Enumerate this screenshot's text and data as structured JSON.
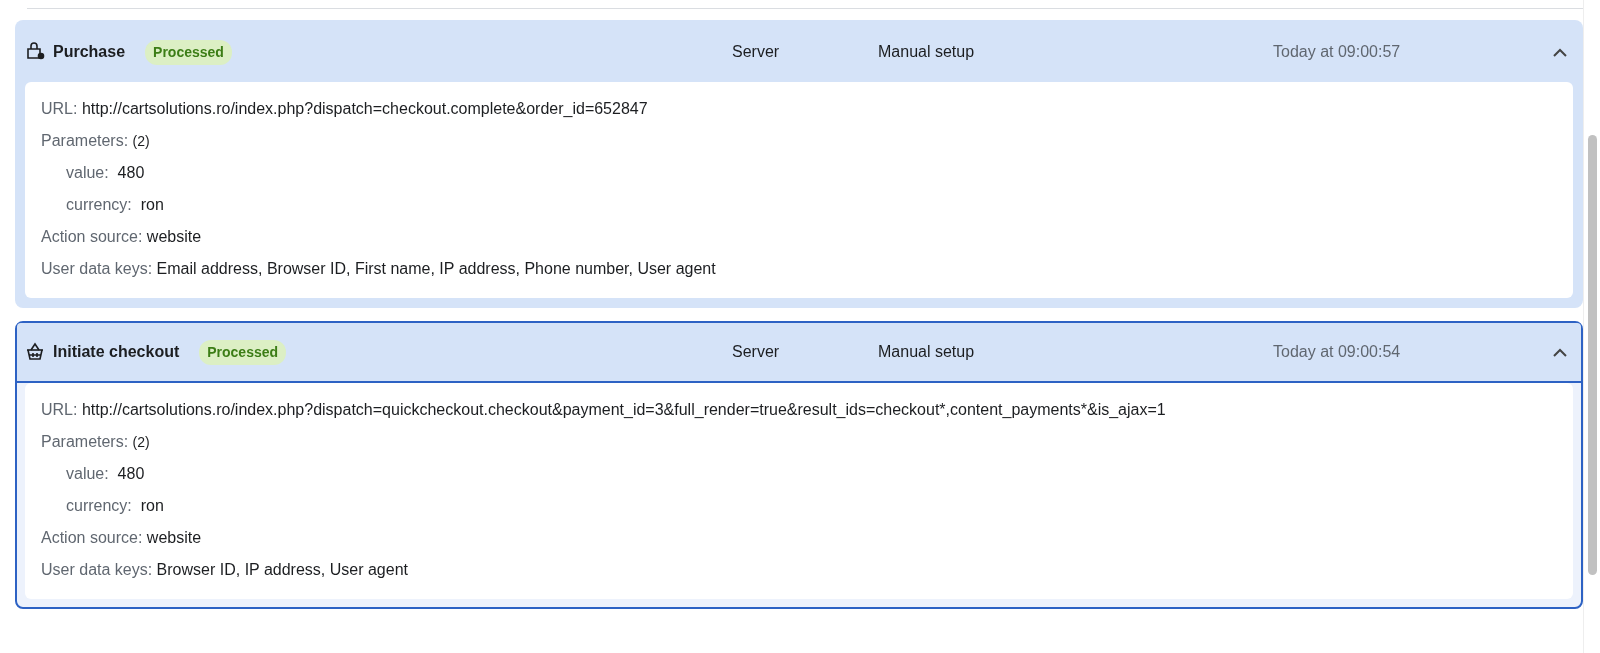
{
  "events": [
    {
      "name": "Purchase",
      "kind": "purchase",
      "status": "Processed",
      "source": "Server",
      "method": "Manual setup",
      "time": "Today at 09:00:57",
      "expanded": true,
      "selected": false,
      "url_label": "URL:",
      "url": "http://cartsolutions.ro/index.php?dispatch=checkout.complete&order_id=652847",
      "parameters_label": "Parameters:",
      "parameters_count": "(2)",
      "parameters": [
        {
          "key": "value:",
          "value": "480"
        },
        {
          "key": "currency:",
          "value": "ron"
        }
      ],
      "action_source_label": "Action source:",
      "action_source": "website",
      "user_data_label": "User data keys:",
      "user_data": "Email address, Browser ID, First name, IP address, Phone number, User agent"
    },
    {
      "name": "Initiate checkout",
      "kind": "checkout",
      "status": "Processed",
      "source": "Server",
      "method": "Manual setup",
      "time": "Today at 09:00:54",
      "expanded": true,
      "selected": true,
      "url_label": "URL:",
      "url": "http://cartsolutions.ro/index.php?dispatch=quickcheckout.checkout&payment_id=3&full_render=true&result_ids=checkout*,content_payments*&is_ajax=1",
      "parameters_label": "Parameters:",
      "parameters_count": "(2)",
      "parameters": [
        {
          "key": "value:",
          "value": "480"
        },
        {
          "key": "currency:",
          "value": "ron"
        }
      ],
      "action_source_label": "Action source:",
      "action_source": "website",
      "user_data_label": "User data keys:",
      "user_data": "Browser ID, IP address, User agent"
    }
  ]
}
